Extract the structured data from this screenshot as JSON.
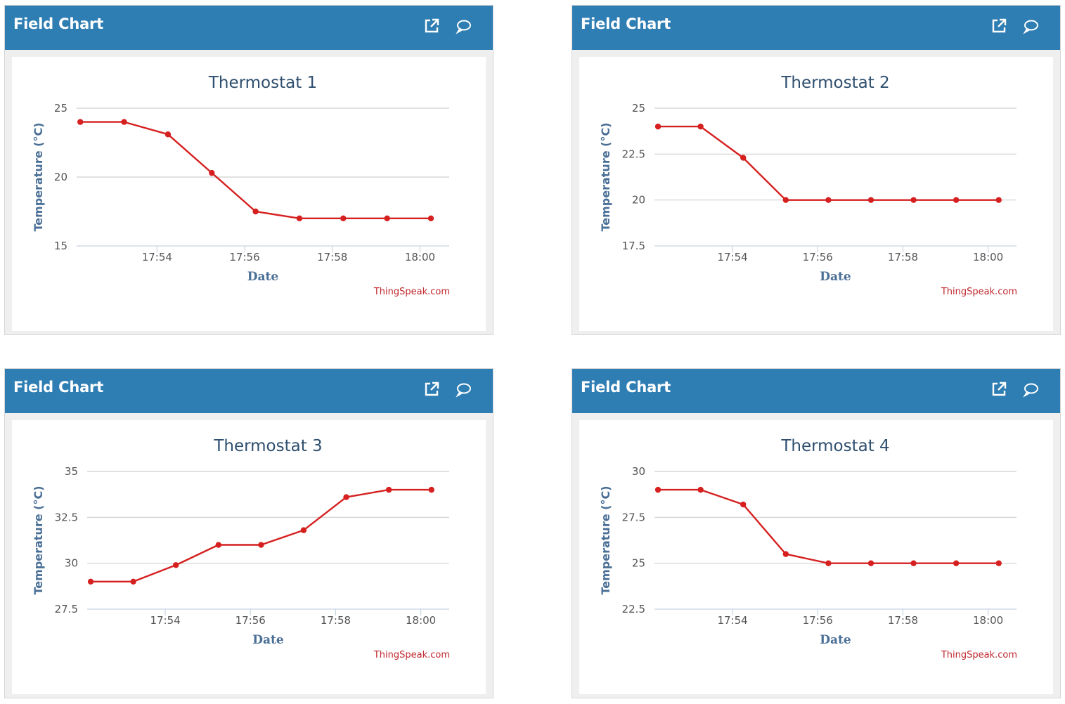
{
  "panels": [
    {
      "header_title": "Field Chart",
      "icons": {
        "open": "external-link-icon",
        "comment": "comment-icon"
      },
      "chart_data": {
        "type": "line",
        "title": "Thermostat 1",
        "xlabel": "Date",
        "ylabel": "Temperature (°C)",
        "x_ticks": [
          "17:54",
          "17:56",
          "17:58",
          "18:00"
        ],
        "y_ticks": [
          "15",
          "20",
          "25"
        ],
        "ylim": [
          15,
          25
        ],
        "xlim": [
          "17:52:10",
          "18:00:40"
        ],
        "series": [
          {
            "x": [
              "17:52:15",
              "17:53:15",
              "17:54:15",
              "17:55:15",
              "17:56:15",
              "17:57:15",
              "17:58:15",
              "17:59:15",
              "18:00:15"
            ],
            "y": [
              24,
              24,
              23.1,
              20.3,
              17.5,
              17,
              17,
              17,
              17
            ]
          }
        ],
        "grid": true,
        "credits": "ThingSpeak.com",
        "line_color": "#d62020"
      }
    },
    {
      "header_title": "Field Chart",
      "icons": {
        "open": "external-link-icon",
        "comment": "comment-icon"
      },
      "chart_data": {
        "type": "line",
        "title": "Thermostat 2",
        "xlabel": "Date",
        "ylabel": "Temperature (°C)",
        "x_ticks": [
          "17:54",
          "17:56",
          "17:58",
          "18:00"
        ],
        "y_ticks": [
          "17.5",
          "20",
          "22.5",
          "25"
        ],
        "ylim": [
          17.5,
          25
        ],
        "xlim": [
          "17:52:10",
          "18:00:40"
        ],
        "series": [
          {
            "x": [
              "17:52:15",
              "17:53:15",
              "17:54:15",
              "17:55:15",
              "17:56:15",
              "17:57:15",
              "17:58:15",
              "17:59:15",
              "18:00:15"
            ],
            "y": [
              24,
              24,
              22.3,
              20,
              20,
              20,
              20,
              20,
              20
            ]
          }
        ],
        "grid": true,
        "credits": "ThingSpeak.com",
        "line_color": "#d62020"
      }
    },
    {
      "header_title": "Field Chart",
      "icons": {
        "open": "external-link-icon",
        "comment": "comment-icon"
      },
      "chart_data": {
        "type": "line",
        "title": "Thermostat 3",
        "xlabel": "Date",
        "ylabel": "Temperature (°C)",
        "x_ticks": [
          "17:54",
          "17:56",
          "17:58",
          "18:00"
        ],
        "y_ticks": [
          "27.5",
          "30",
          "32.5",
          "35"
        ],
        "ylim": [
          27.5,
          35
        ],
        "xlim": [
          "17:52:10",
          "18:00:40"
        ],
        "series": [
          {
            "x": [
              "17:52:15",
              "17:53:15",
              "17:54:15",
              "17:55:15",
              "17:56:15",
              "17:57:15",
              "17:58:15",
              "17:59:15",
              "18:00:15"
            ],
            "y": [
              29,
              29,
              29.9,
              31,
              31,
              31.8,
              33.6,
              34,
              34
            ]
          }
        ],
        "grid": true,
        "credits": "ThingSpeak.com",
        "line_color": "#d62020"
      }
    },
    {
      "header_title": "Field Chart",
      "icons": {
        "open": "external-link-icon",
        "comment": "comment-icon"
      },
      "chart_data": {
        "type": "line",
        "title": "Thermostat 4",
        "xlabel": "Date",
        "ylabel": "Temperature (°C)",
        "x_ticks": [
          "17:54",
          "17:56",
          "17:58",
          "18:00"
        ],
        "y_ticks": [
          "22.5",
          "25",
          "27.5",
          "30"
        ],
        "ylim": [
          22.5,
          30
        ],
        "xlim": [
          "17:52:10",
          "18:00:40"
        ],
        "series": [
          {
            "x": [
              "17:52:15",
              "17:53:15",
              "17:54:15",
              "17:55:15",
              "17:56:15",
              "17:57:15",
              "17:58:15",
              "17:59:15",
              "18:00:15"
            ],
            "y": [
              29,
              29,
              28.2,
              25.5,
              25,
              25,
              25,
              25,
              25
            ]
          }
        ],
        "grid": true,
        "credits": "ThingSpeak.com",
        "line_color": "#d62020"
      }
    }
  ]
}
